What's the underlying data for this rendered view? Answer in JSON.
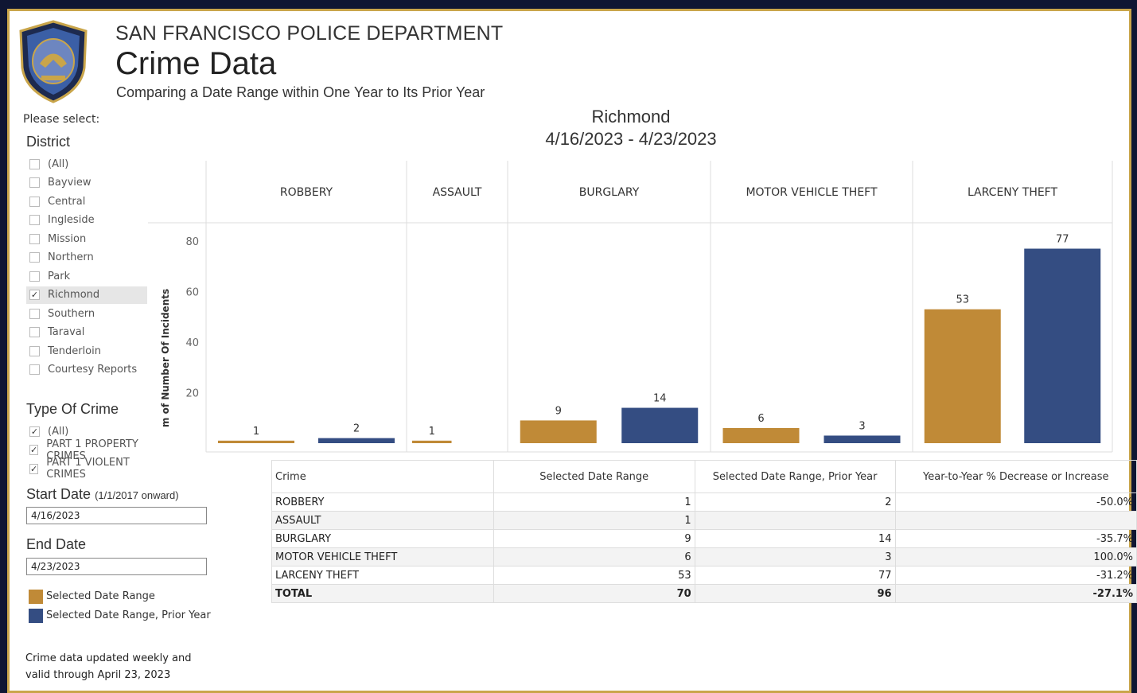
{
  "header": {
    "department": "SAN FRANCISCO POLICE DEPARTMENT",
    "title": "Crime Data",
    "subtitle": "Comparing a Date Range within One Year to Its Prior Year"
  },
  "filters": {
    "please_select": "Please select:",
    "district_label": "District",
    "districts": [
      {
        "label": "(All)",
        "checked": false
      },
      {
        "label": "Bayview",
        "checked": false
      },
      {
        "label": "Central",
        "checked": false
      },
      {
        "label": "Ingleside",
        "checked": false
      },
      {
        "label": "Mission",
        "checked": false
      },
      {
        "label": "Northern",
        "checked": false
      },
      {
        "label": "Park",
        "checked": false
      },
      {
        "label": "Richmond",
        "checked": true
      },
      {
        "label": "Southern",
        "checked": false
      },
      {
        "label": "Taraval",
        "checked": false
      },
      {
        "label": "Tenderloin",
        "checked": false
      },
      {
        "label": "Courtesy Reports",
        "checked": false
      }
    ],
    "type_label": "Type Of Crime",
    "types": [
      {
        "label": "(All)",
        "checked": true
      },
      {
        "label": "PART 1 PROPERTY CRIMES",
        "checked": true
      },
      {
        "label": "PART 1 VIOLENT CRIMES",
        "checked": true
      }
    ],
    "start_label": "Start Date",
    "start_hint": "(1/1/2017 onward)",
    "start_value": "4/16/2023",
    "end_label": "End Date",
    "end_value": "4/23/2023"
  },
  "legend": {
    "selected": "Selected Date Range",
    "prior": "Selected Date Range, Prior Year"
  },
  "note": {
    "line1": "Crime data updated weekly and",
    "line2": "valid through April 23, 2023"
  },
  "colors": {
    "selected": "#c08a37",
    "prior": "#344d82",
    "accent": "#c9a54a",
    "background": "#0f1633"
  },
  "chart_data": {
    "type": "bar",
    "title": "Richmond",
    "subtitle": "4/16/2023 - 4/23/2023",
    "ylabel": "m of Number Of Incidents",
    "ylim": [
      0,
      85
    ],
    "yticks": [
      20,
      40,
      60,
      80
    ],
    "categories": [
      "ROBBERY",
      "ASSAULT",
      "BURGLARY",
      "MOTOR VEHICLE THEFT",
      "LARCENY THEFT"
    ],
    "series": [
      {
        "name": "Selected Date Range",
        "values": [
          1,
          1,
          9,
          6,
          53
        ]
      },
      {
        "name": "Selected Date Range, Prior Year",
        "values": [
          2,
          null,
          14,
          3,
          77
        ]
      }
    ]
  },
  "table": {
    "headers": [
      "Crime",
      "Selected Date Range",
      "Selected Date Range, Prior Year",
      "Year-to-Year % Decrease or Increase"
    ],
    "rows": [
      [
        "ROBBERY",
        "1",
        "2",
        "-50.0%"
      ],
      [
        "ASSAULT",
        "1",
        "",
        ""
      ],
      [
        "BURGLARY",
        "9",
        "14",
        "-35.7%"
      ],
      [
        "MOTOR VEHICLE THEFT",
        "6",
        "3",
        "100.0%"
      ],
      [
        "LARCENY THEFT",
        "53",
        "77",
        "-31.2%"
      ],
      [
        "TOTAL",
        "70",
        "96",
        "-27.1%"
      ]
    ]
  }
}
